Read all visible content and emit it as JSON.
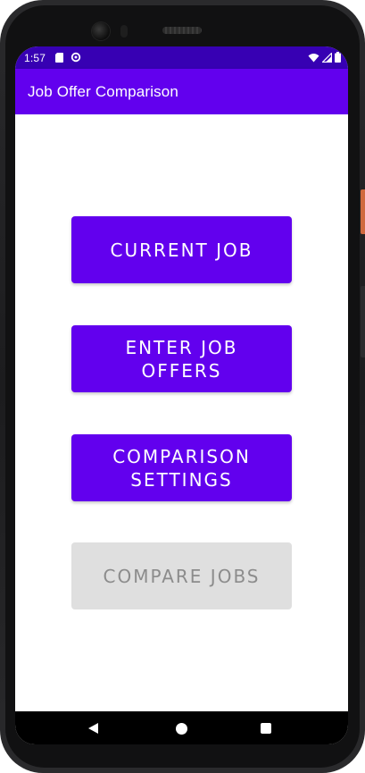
{
  "status_bar": {
    "time": "1:57",
    "icons": [
      "sd-card-icon",
      "sync-icon",
      "wifi-icon",
      "cell-signal-icon",
      "battery-icon"
    ]
  },
  "app_bar": {
    "title": "Job Offer Comparison"
  },
  "buttons": {
    "current_job": "CURRENT JOB",
    "enter_job_offers": "ENTER JOB\nOFFERS",
    "comparison_settings": "COMPARISON\nSETTINGS",
    "compare_jobs": "COMPARE JOBS"
  },
  "button_states": {
    "compare_jobs_enabled": false
  },
  "navigation": {
    "icons": [
      "back-icon",
      "home-icon",
      "recents-icon"
    ]
  },
  "colors": {
    "status_bar": "#3700b3",
    "primary": "#6200ee",
    "button_text": "#ffffff",
    "disabled_bg": "#dfdfdf",
    "disabled_text": "#8c8c8c",
    "nav_bar": "#000000"
  }
}
